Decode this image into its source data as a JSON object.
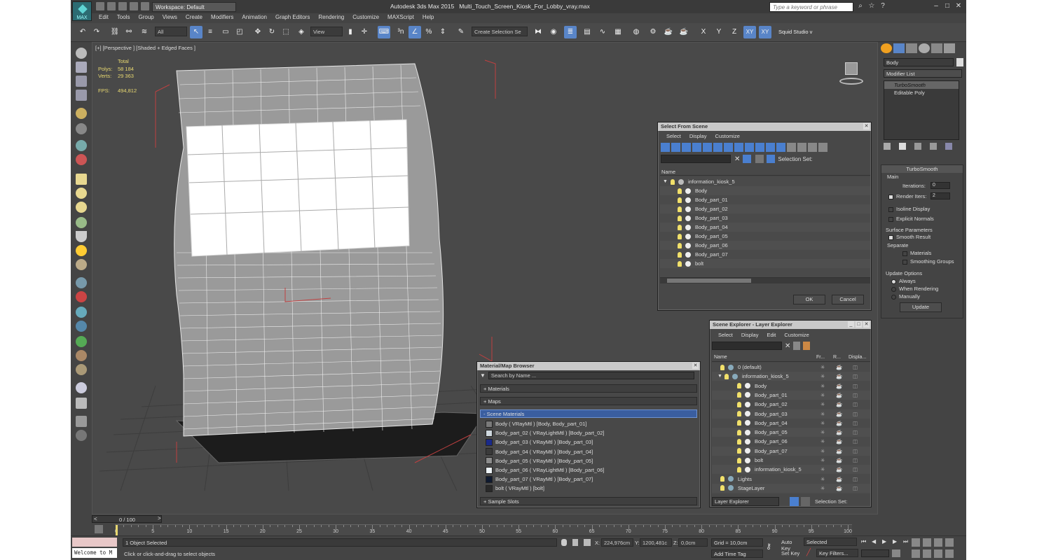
{
  "app": {
    "title": "Autodesk 3ds Max  2015",
    "filename": "Multi_Touch_Screen_Kiosk_For_Lobby_vray.max",
    "logo_text": "MAX",
    "workspace": "Workspace: Default",
    "search_placeholder": "Type a keyword or phrase"
  },
  "menu": [
    "Edit",
    "Tools",
    "Group",
    "Views",
    "Create",
    "Modifiers",
    "Animation",
    "Graph Editors",
    "Rendering",
    "Customize",
    "MAXScript",
    "Help"
  ],
  "toolbar": {
    "filter": "All",
    "ref_coord": "View",
    "selection_set": "Create Selection Se",
    "axis_x": "X",
    "axis_y": "Y",
    "axis_z": "Z",
    "axis_xy": "XY",
    "axis_xy2": "XY",
    "workspace_name": "Squid Studio v"
  },
  "viewport": {
    "label": "[+] [Perspective ] [Shaded + Edged Faces ]",
    "stats": {
      "total": "Total",
      "polys_label": "Polys:",
      "polys": "58 184",
      "verts_label": "Verts:",
      "verts": "29 363",
      "fps_label": "FPS:",
      "fps": "494,812"
    }
  },
  "select_from_scene": {
    "title": "Select From Scene",
    "menu": [
      "Select",
      "Display",
      "Customize"
    ],
    "selection_set_label": "Selection Set:",
    "col_name": "Name",
    "items": [
      "information_kiosk_5",
      "Body",
      "Body_part_01",
      "Body_part_02",
      "Body_part_03",
      "Body_part_04",
      "Body_part_05",
      "Body_part_06",
      "Body_part_07",
      "bolt"
    ],
    "ok": "OK",
    "cancel": "Cancel"
  },
  "layer_explorer": {
    "title": "Scene Explorer - Layer Explorer",
    "menu": [
      "Select",
      "Display",
      "Edit",
      "Customize"
    ],
    "cols": [
      "Name",
      "Fr...",
      "R...",
      "Displa..."
    ],
    "items": [
      "0 (default)",
      "information_kiosk_5",
      "Body",
      "Body_part_01",
      "Body_part_02",
      "Body_part_03",
      "Body_part_04",
      "Body_part_05",
      "Body_part_06",
      "Body_part_07",
      "bolt",
      "information_kiosk_5",
      "Lights",
      "StageLayer"
    ],
    "footer_dropdown": "Layer Explorer",
    "selection_set_label": "Selection Set:"
  },
  "material_browser": {
    "title": "Material/Map Browser",
    "search_placeholder": "Search by Name ...",
    "sections": [
      "+ Materials",
      "+ Maps",
      "- Scene Materials"
    ],
    "materials": [
      {
        "label": "Body  ( VRayMtl ) [Body, Body_part_01]",
        "color": "#7a7a7a"
      },
      {
        "label": "Body_part_02  ( VRayLightMtl ) [Body_part_02]",
        "color": "#cfd8de"
      },
      {
        "label": "Body_part_03  ( VRayMtl ) [Body_part_03]",
        "color": "#1a2a8a"
      },
      {
        "label": "Body_part_04  ( VRayMtl ) [Body_part_04]",
        "color": "#3a3a3a"
      },
      {
        "label": "Body_part_05  ( VRayMtl ) [Body_part_05]",
        "color": "#8c8c8c"
      },
      {
        "label": "Body_part_06  ( VRayLightMtl ) [Body_part_06]",
        "color": "#eef4f8"
      },
      {
        "label": "Body_part_07  ( VRayMtl ) [Body_part_07]",
        "color": "#0f1a30"
      },
      {
        "label": "bolt  ( VRayMtl ) [bolt]",
        "color": "#2a2a2a"
      }
    ],
    "sample_slots": "+ Sample Slots"
  },
  "command_panel": {
    "object_name": "Body",
    "modifier_list": "Modifier List",
    "stack": [
      "TurboSmooth",
      "Editable Poly"
    ],
    "rollout_title": "TurboSmooth",
    "main": "Main",
    "iterations_label": "Iterations:",
    "iterations": "0",
    "render_iters_label": "Render Iters:",
    "render_iters": "2",
    "isoline": "Isoline Display",
    "explicit": "Explicit Normals",
    "surface_params": "Surface Parameters",
    "smooth_result": "Smooth Result",
    "separate": "Separate",
    "materials": "Materials",
    "smoothing_groups": "Smoothing Groups",
    "update_options": "Update Options",
    "always": "Always",
    "when_rendering": "When Rendering",
    "manually": "Manually",
    "update_btn": "Update"
  },
  "timeline": {
    "frame": "0 / 100",
    "ticks": [
      "0",
      "5",
      "10",
      "15",
      "20",
      "25",
      "30",
      "35",
      "40",
      "45",
      "50",
      "55",
      "60",
      "65",
      "70",
      "75",
      "80",
      "85",
      "90",
      "95",
      "100"
    ]
  },
  "status": {
    "script": "Welcome to M",
    "selected": "1 Object Selected",
    "prompt": "Click or click-and-drag to select objects",
    "x_label": "X:",
    "x": "224,976cm",
    "y_label": "Y:",
    "y": "1200,481c",
    "z_label": "Z:",
    "z": "0,0cm",
    "grid": "Grid = 10,0cm",
    "add_time_tag": "Add Time Tag",
    "auto_key": "Auto Key",
    "set_key": "Set Key",
    "key_mode": "Selected",
    "key_filters": "Key Filters..."
  }
}
